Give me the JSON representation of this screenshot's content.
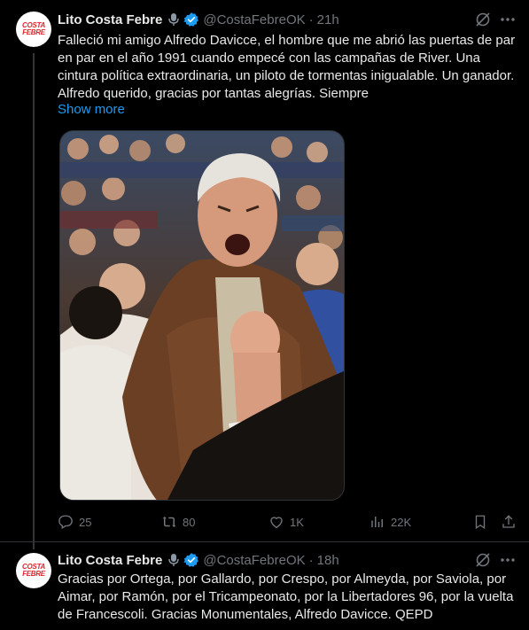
{
  "tweets": [
    {
      "avatar_text": [
        "COSTA",
        "FEBRE"
      ],
      "name": "Lito Costa Febre",
      "handle": "@CostaFebreOK",
      "time": "21h",
      "text": "Falleció mi amigo Alfredo Davicce, el hombre que me abrió las puertas de par en par en el año 1991 cuando empecé con las campañas de River. Una cintura política extraordinaria, un piloto de tormentas inigualable. Un ganador. Alfredo querido, gracias por tantas alegrías. Siempre",
      "show_more": "Show more",
      "actions": {
        "replies": "25",
        "retweets": "80",
        "likes": "1K",
        "views": "22K"
      }
    },
    {
      "avatar_text": [
        "COSTA",
        "FEBRE"
      ],
      "name": "Lito Costa Febre",
      "handle": "@CostaFebreOK",
      "time": "18h",
      "text": "Gracias por Ortega, por Gallardo, por Crespo, por Almeyda, por Saviola, por Aimar, por Ramón, por el Tricampeonato, por la Libertadores 96, por la vuelta de Francescoli. Gracias Monumentales, Alfredo Davicce. QEPD"
    }
  ],
  "colors": {
    "background": "#000000",
    "text": "#e7e9ea",
    "muted": "#71767b",
    "link": "#1d9bf0",
    "verified": "#1d9bf0",
    "avatar_red": "#e0242c"
  },
  "icons": [
    "microphone-icon",
    "verified-badge-icon",
    "grok-icon",
    "more-icon",
    "reply-icon",
    "retweet-icon",
    "like-icon",
    "views-icon",
    "bookmark-icon",
    "share-icon"
  ]
}
